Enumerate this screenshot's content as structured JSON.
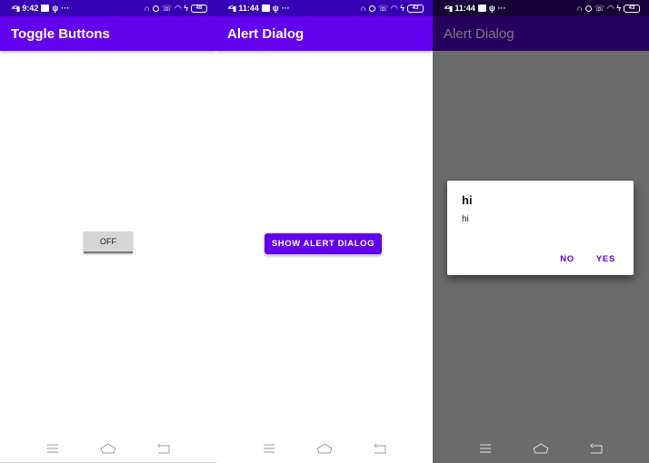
{
  "colors": {
    "primary": "#6200ee",
    "primary_dark": "#3700b3",
    "dimmed_statusbar": "#170037",
    "dimmed_appbar": "#27005f",
    "dimmed_appbar_text": "#7a7a7a",
    "scrim": "#6b6b6b"
  },
  "screens": [
    {
      "statusbar": {
        "time": "9:42",
        "battery": "48"
      },
      "appbar": {
        "title": "Toggle Buttons"
      },
      "toggle": {
        "label": "OFF"
      }
    },
    {
      "statusbar": {
        "time": "11:44",
        "battery": "43"
      },
      "appbar": {
        "title": "Alert Dialog"
      },
      "button": {
        "label": "SHOW ALERT DIALOG"
      }
    },
    {
      "statusbar": {
        "time": "11:44",
        "battery": "43"
      },
      "appbar": {
        "title": "Alert Dialog"
      },
      "dialog": {
        "title": "hi",
        "message": "hi",
        "negative_label": "NO",
        "positive_label": "YES"
      }
    }
  ],
  "status_icons": [
    "signal-icon",
    "notification-icon",
    "usb-icon",
    "more-icon",
    "headset-icon",
    "alarm-icon",
    "call-icon",
    "wifi-icon",
    "charging-icon",
    "battery-icon"
  ],
  "nav_icons": [
    "menu-icon",
    "home-icon",
    "back-icon"
  ]
}
